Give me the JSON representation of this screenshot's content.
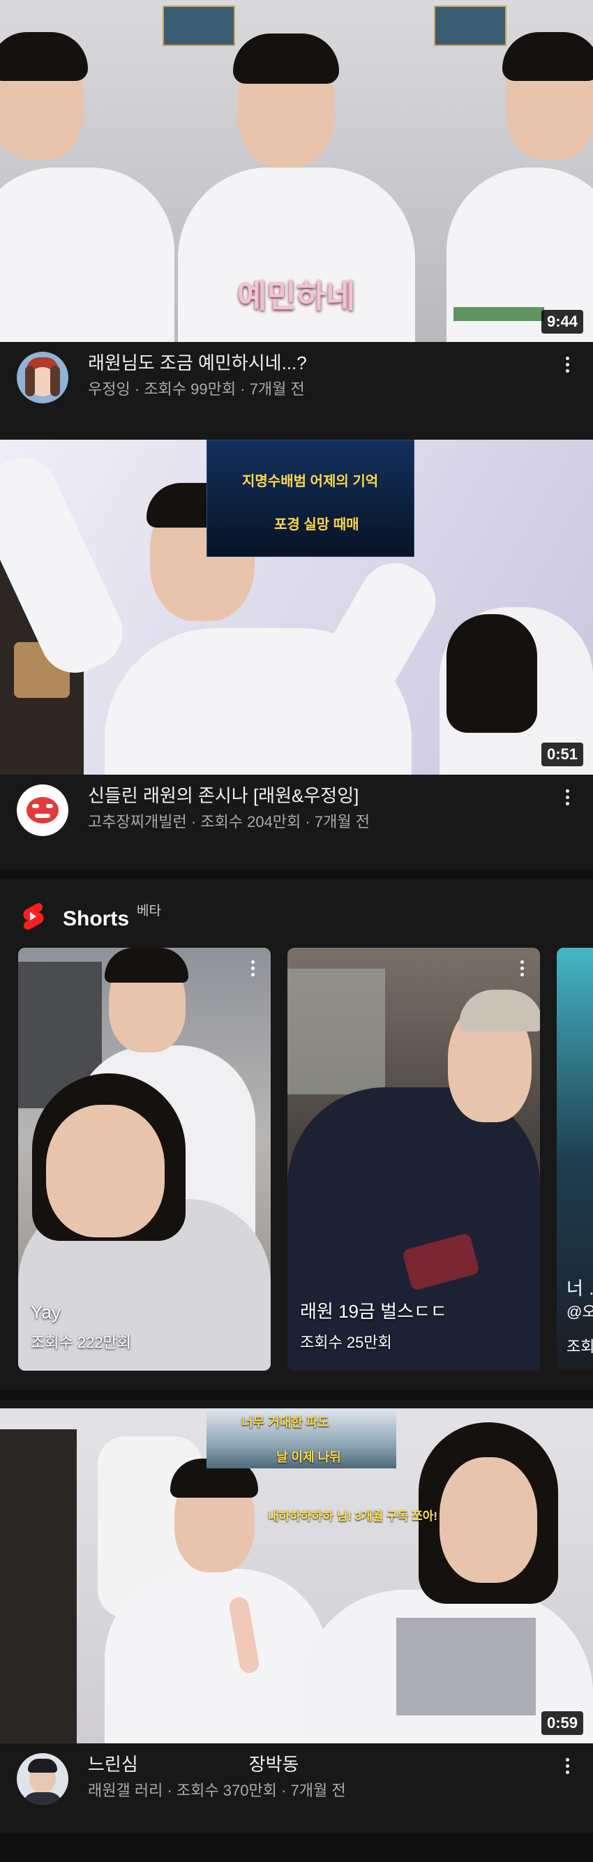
{
  "videos": [
    {
      "title": "래원님도 조금 예민하시네...?",
      "channel": "우정잉",
      "views": "조회수 99만회",
      "age": "7개월 전",
      "duration": "9:44",
      "caption_overlay": "예민하네"
    },
    {
      "title": "신들린 래원의 존시나 [래원&우정잉]",
      "channel": "고추장찌개빌런",
      "views": "조회수 204만회",
      "age": "7개월 전",
      "duration": "0:51",
      "overlay_line1": "지명수배범 어제의 기억",
      "overlay_line2": "포경 실망 때매"
    },
    {
      "title": "느린심                      장박동",
      "channel": "래원갤 러리",
      "views": "조회수 370만회",
      "age": "7개월 전",
      "duration": "0:59",
      "overlay_line1": "너무 거대한 파도",
      "overlay_line2": "날 이제 나뒤",
      "overlay_line3": "내하하하하하 님! 3개월 구독 쪼아!"
    }
  ],
  "shorts": {
    "header": "Shorts",
    "badge": "베타",
    "items": [
      {
        "title": "Yay",
        "views": "조회수 222만회"
      },
      {
        "title": "래원 19금 벌스ㄷㄷ",
        "views": "조회수 25만회"
      },
      {
        "title": "너 …",
        "subtitle": "@오",
        "views": "조회"
      }
    ]
  },
  "separator_dot": "·"
}
